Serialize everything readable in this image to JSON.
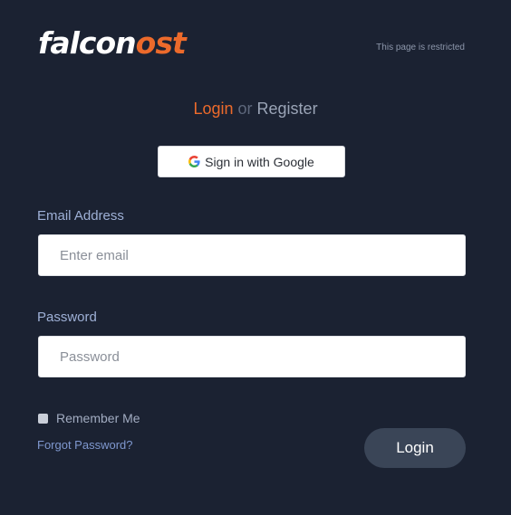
{
  "brand": {
    "logo_white": "falcon",
    "logo_orange": "ost",
    "restricted_note": "This page is restricted"
  },
  "auth_tabs": {
    "login": "Login",
    "or": "or",
    "register": "Register"
  },
  "google": {
    "label": "Sign in with Google",
    "icon": "google-icon"
  },
  "form": {
    "email_label": "Email Address",
    "email_placeholder": "Enter email",
    "email_value": "",
    "password_label": "Password",
    "password_placeholder": "Password",
    "password_value": "",
    "remember_label": "Remember Me",
    "remember_checked": false,
    "forgot_label": "Forgot Password?",
    "submit_label": "Login"
  },
  "colors": {
    "background": "#1b2232",
    "accent": "#ec6a2b",
    "label": "#9eb0d6",
    "button": "#3a4557"
  }
}
